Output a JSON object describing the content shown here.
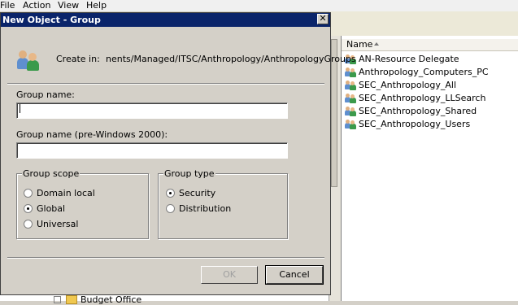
{
  "menu": [
    "File",
    "Action",
    "View",
    "Help"
  ],
  "dialog": {
    "title": "New Object - Group",
    "close_symbol": "✕",
    "create_in_label": "Create in:",
    "create_in_path": "nents/Managed/ITSC/Anthropology/AnthropologyGroups",
    "group_name_label": "Group name:",
    "group_name_value": "",
    "pre2000_label": "Group name (pre-Windows 2000):",
    "pre2000_value": "",
    "scope": {
      "title": "Group scope",
      "options": [
        "Domain local",
        "Global",
        "Universal"
      ],
      "selected": "Global"
    },
    "type": {
      "title": "Group type",
      "options": [
        "Security",
        "Distribution"
      ],
      "selected": "Security"
    },
    "ok_label": "OK",
    "cancel_label": "Cancel"
  },
  "list": {
    "header": "Name",
    "items": [
      "AN-Resource Delegate",
      "Anthropology_Computers_PC",
      "SEC_Anthropology_All",
      "SEC_Anthropology_LLSearch",
      "SEC_Anthropology_Shared",
      "SEC_Anthropology_Users"
    ]
  },
  "tree": {
    "bottom_item": "Budget Office"
  },
  "colors": {
    "titlebar": "#0a246a",
    "dialog_bg": "#d4d0c8"
  }
}
